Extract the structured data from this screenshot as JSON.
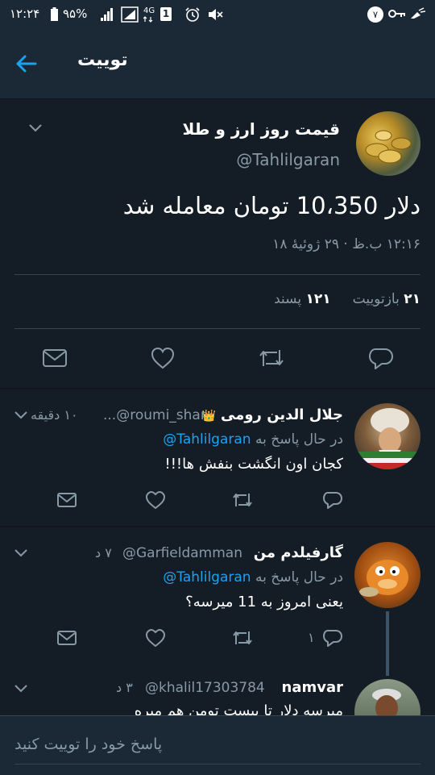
{
  "status_bar": {
    "time": "۱۲:۲۴",
    "battery": "۹۵%",
    "network": "4G",
    "sim": "1",
    "notification_count": "۷"
  },
  "header": {
    "title": "توییت"
  },
  "main_tweet": {
    "display_name": "قیمت روز ارز و طلا",
    "handle": "@Tahlilgaran",
    "text": "دلار 10،350 تومان معامله شد",
    "timestamp": "۱۲:۱۶ ب.ظ · ۲۹ ژوئیهٔ ۱۸",
    "retweet_count": "۲۱",
    "retweet_label": "بازتوییت",
    "like_count": "۱۲۱",
    "like_label": "پسند"
  },
  "replies": [
    {
      "display_name": "جلال الدين رومی",
      "crown": "👑",
      "handle": "...@roumi_shar",
      "time": "۱۰ دقیقه",
      "replying_label": "در حال پاسخ به",
      "replying_to": "@Tahlilgaran",
      "text": "کجان اون انگشت بنفش ها!!!",
      "reply_count": ""
    },
    {
      "display_name": "گارفیلدم من",
      "handle": "@Garfieldamman",
      "time": "۷ د",
      "replying_label": "در حال پاسخ به",
      "replying_to": "@Tahlilgaran",
      "text": "یعنی امروز به 11 میرسه؟",
      "reply_count": "۱"
    },
    {
      "display_name": "namvar",
      "handle": "@khalil17303784",
      "time": "۳ د",
      "text": "میرسه دلار تا بیست تومن هم میره"
    }
  ],
  "reply_bar": {
    "placeholder": "پاسخ خود را توییت کنید"
  },
  "colors": {
    "background": "#141d26",
    "header": "#1b2836",
    "accent": "#1da1f2",
    "muted": "#8899a6",
    "divider": "#38444d"
  },
  "icons": [
    "back-arrow-icon",
    "chevron-down-icon",
    "reply-icon",
    "retweet-icon",
    "like-icon",
    "dm-icon",
    "crown-icon"
  ]
}
